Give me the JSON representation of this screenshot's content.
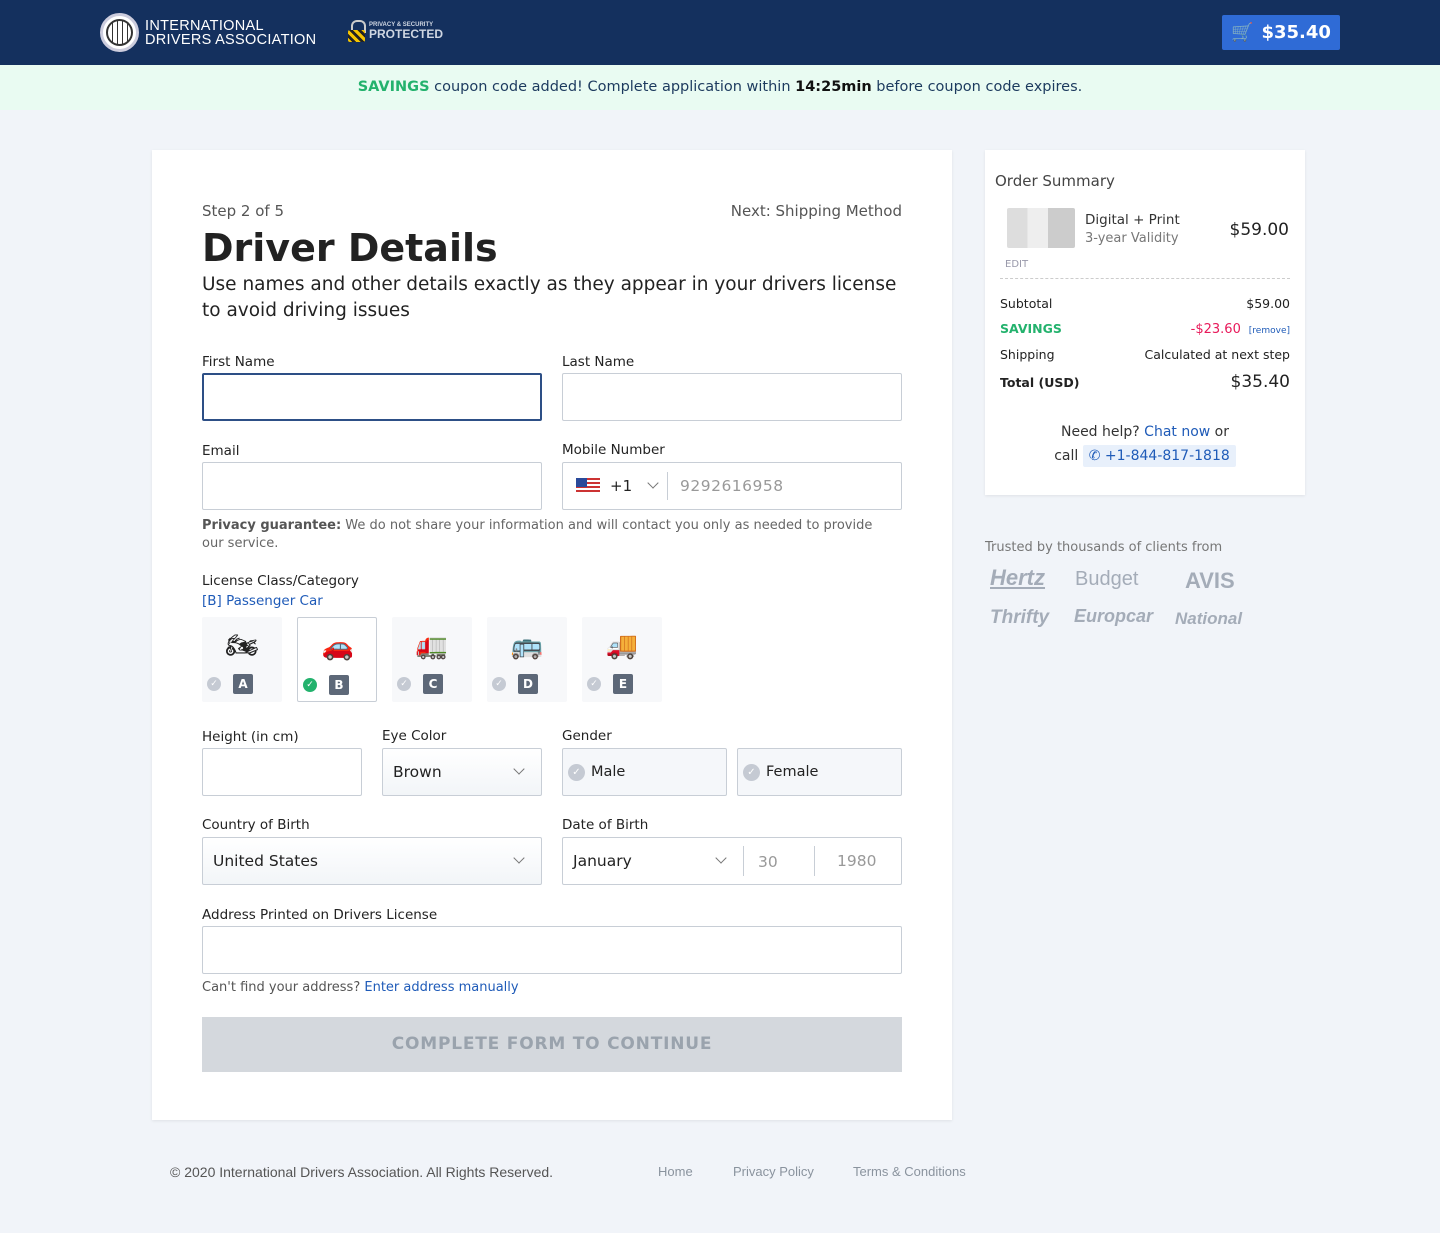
{
  "header": {
    "logo_line1": "INTERNATIONAL",
    "logo_line2": "DRIVERS ASSOCIATION",
    "security_line1": "PRIVACY & SECURITY",
    "security_line2": "PROTECTED",
    "cart_total": "$35.40",
    "cart_icon": "cart-icon"
  },
  "banner": {
    "code": "SAVINGS",
    "text1": " coupon code added! Complete application within ",
    "time": "14:25min",
    "text2": " before coupon code expires."
  },
  "form": {
    "step": "Step 2 of 5",
    "next": "Next: Shipping Method",
    "title": "Driver Details",
    "intro": "Use names and other details exactly as they appear in your drivers license to avoid driving issues",
    "first_name_label": "First Name",
    "first_name_value": "",
    "last_name_label": "Last Name",
    "last_name_value": "",
    "email_label": "Email",
    "email_value": "",
    "mobile_label": "Mobile Number",
    "country_code": "+1",
    "mobile_placeholder": "9292616958",
    "privacy_bold": "Privacy guarantee:",
    "privacy_text": " We do not share your information and will contact you only as needed to provide our service.",
    "license_label": "License Class/Category",
    "license_selected": "[B] Passenger Car",
    "license_classes": [
      {
        "letter": "A",
        "icon": "motorcycle-icon",
        "glyph": "🏍",
        "selected": false
      },
      {
        "letter": "B",
        "icon": "car-icon",
        "glyph": "🚗",
        "selected": true
      },
      {
        "letter": "C",
        "icon": "truck-icon",
        "glyph": "🚛",
        "selected": false
      },
      {
        "letter": "D",
        "icon": "bus-icon",
        "glyph": "🚌",
        "selected": false
      },
      {
        "letter": "E",
        "icon": "trailer-icon",
        "glyph": "🚚",
        "selected": false
      }
    ],
    "height_label": "Height (in cm)",
    "height_value": "",
    "eye_label": "Eye Color",
    "eye_value": "Brown",
    "gender_label": "Gender",
    "gender_options": [
      "Male",
      "Female"
    ],
    "country_label": "Country of Birth",
    "country_value": "United States",
    "dob_label": "Date of Birth",
    "dob_month": "January",
    "dob_day_placeholder": "30",
    "dob_year_placeholder": "1980",
    "address_label": "Address Printed on Drivers License",
    "address_value": "",
    "address_help": "Can't find your address? ",
    "address_link": "Enter address manually",
    "submit": "COMPLETE FORM TO CONTINUE"
  },
  "summary": {
    "title": "Order Summary",
    "product": "Digital + Print",
    "validity": "3-year Validity",
    "price": "$59.00",
    "edit": "EDIT",
    "subtotal_label": "Subtotal",
    "subtotal": "$59.00",
    "savings_label": "SAVINGS",
    "savings": "-$23.60",
    "remove": "[remove]",
    "shipping_label": "Shipping",
    "shipping": "Calculated at next step",
    "total_label": "Total (USD)",
    "total": "$35.40",
    "help1": "Need help? ",
    "chat": "Chat now",
    "help2": " or",
    "call": "call ",
    "phone": "+1-844-817-1818",
    "colors": {
      "savings": "#23b26d",
      "discount": "#e8195a",
      "link": "#1f5bb8"
    }
  },
  "trusted": {
    "text": "Trusted by thousands of clients from",
    "brands": [
      "Hertz",
      "Budget",
      "AVIS",
      "Thrifty",
      "Europcar",
      "National"
    ]
  },
  "footer": {
    "copyright": "© 2020 International Drivers Association. All Rights Reserved.",
    "links": [
      "Home",
      "Privacy Policy",
      "Terms & Conditions"
    ]
  }
}
